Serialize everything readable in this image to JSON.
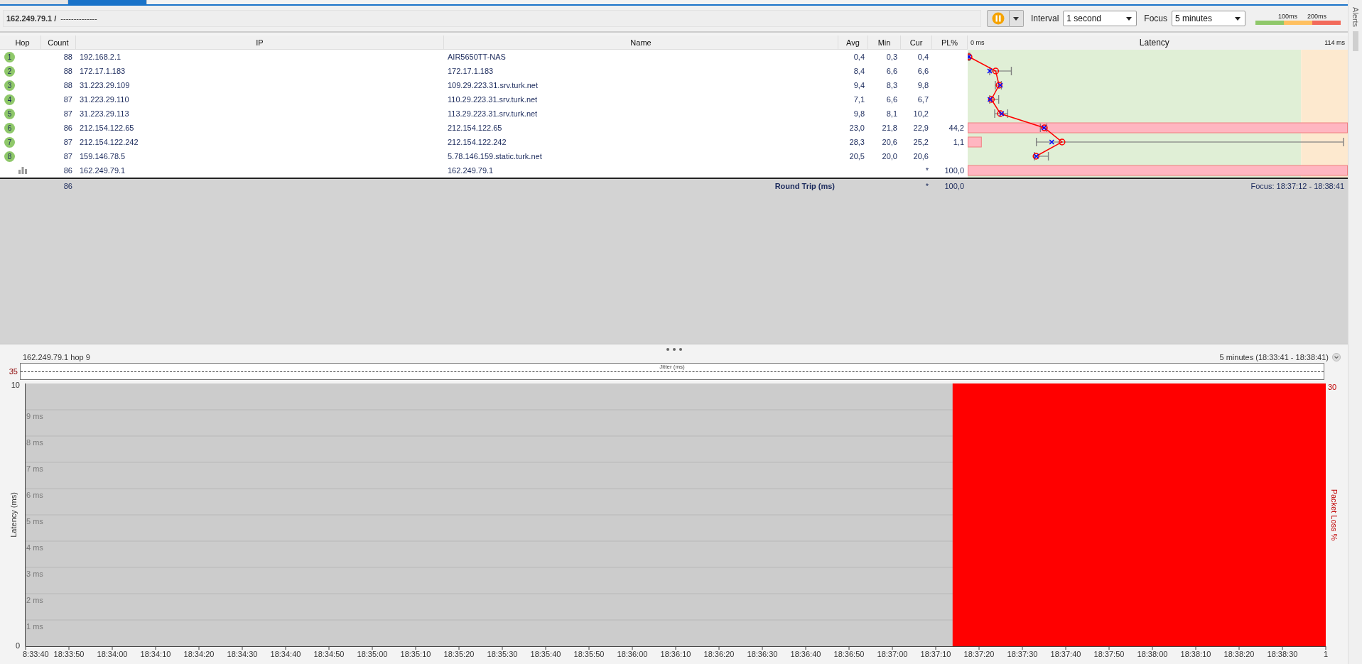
{
  "tabs": [
    {
      "selected": false
    },
    {
      "selected": true
    }
  ],
  "toolbar": {
    "host": "162.249.79.1 /",
    "path": "--------------",
    "running": true,
    "interval": {
      "label": "Interval",
      "value": "1 second"
    },
    "focus": {
      "label": "Focus",
      "value": "5 minutes"
    },
    "legend": [
      "100ms",
      "200ms"
    ]
  },
  "alerts_tab": {
    "label": "Alerts"
  },
  "table": {
    "columns": [
      "Hop",
      "Count",
      "IP",
      "Name",
      "Avg",
      "Min",
      "Cur",
      "PL%"
    ],
    "latency_column": {
      "title": "Latency",
      "min_label": "0 ms",
      "max_label": "114 ms",
      "zones": [
        {
          "color": "#e0efd6",
          "level": 0.877
        },
        {
          "color": "#fde9cf",
          "level": 1
        }
      ]
    },
    "rows": [
      {
        "kind": "hop",
        "hop": "1",
        "count": "88",
        "ip": "192.168.2.1",
        "name": "AIR5650TT-NAS",
        "avg": "0,4",
        "min": "0,3",
        "cur": "0,4",
        "avg_mark": {
          "level": 0.0035
        },
        "cur_mark": {
          "level": 0.0035
        },
        "range": {
          "from": {
            "level": 0.0026
          },
          "to": {
            "level": 0.0053
          }
        }
      },
      {
        "kind": "hop",
        "hop": "2",
        "count": "88",
        "ip": "172.17.1.183",
        "name": "172.17.1.183",
        "avg": "8,4",
        "min": "6,6",
        "cur": "6,6",
        "avg_mark": {
          "level": 0.0737
        },
        "cur_mark": {
          "level": 0.0579
        },
        "range": {
          "from": {
            "level": 0.0579
          },
          "to": {
            "level": 0.1149
          }
        }
      },
      {
        "kind": "hop",
        "hop": "3",
        "count": "88",
        "ip": "31.223.29.109",
        "name": "109.29.223.31.srv.turk.net",
        "avg": "9,4",
        "min": "8,3",
        "cur": "9,8",
        "avg_mark": {
          "level": 0.0825
        },
        "cur_mark": {
          "level": 0.086
        },
        "range": {
          "from": {
            "level": 0.0728
          },
          "to": {
            "level": 0.0886
          }
        }
      },
      {
        "kind": "hop",
        "hop": "4",
        "count": "87",
        "ip": "31.223.29.110",
        "name": "110.29.223.31.srv.turk.net",
        "avg": "7,1",
        "min": "6,6",
        "cur": "6,7",
        "avg_mark": {
          "level": 0.0623
        },
        "cur_mark": {
          "level": 0.0588
        },
        "range": {
          "from": {
            "level": 0.0579
          },
          "to": {
            "level": 0.0816
          }
        }
      },
      {
        "kind": "hop",
        "hop": "5",
        "count": "87",
        "ip": "31.223.29.113",
        "name": "113.29.223.31.srv.turk.net",
        "avg": "9,8",
        "min": "8,1",
        "cur": "10,2",
        "avg_mark": {
          "level": 0.086
        },
        "cur_mark": {
          "level": 0.0895
        },
        "range": {
          "from": {
            "level": 0.0711
          },
          "to": {
            "level": 0.1053
          }
        }
      },
      {
        "kind": "hop",
        "hop": "6",
        "count": "86",
        "ip": "212.154.122.65",
        "name": "212.154.122.65",
        "avg": "23,0",
        "min": "21,8",
        "cur": "22,9",
        "pl": "44,2",
        "avg_mark": {
          "level": 0.2018
        },
        "cur_mark": {
          "level": 0.2009
        },
        "range": {
          "from": {
            "level": 0.1912
          },
          "to": {
            "level": 0.2079
          }
        },
        "loss_bar": {
          "level": 1
        }
      },
      {
        "kind": "hop",
        "hop": "7",
        "count": "87",
        "ip": "212.154.122.242",
        "name": "212.154.122.242",
        "avg": "28,3",
        "min": "20,6",
        "cur": "25,2",
        "pl": "1,1",
        "avg_mark": {
          "level": 0.2482
        },
        "cur_mark": {
          "level": 0.2211
        },
        "range": {
          "from": {
            "level": 0.1807
          },
          "to": {
            "level": 0.9886
          }
        },
        "loss_bar": {
          "level": 0.037
        }
      },
      {
        "kind": "hop",
        "hop": "8",
        "count": "87",
        "ip": "159.146.78.5",
        "name": "5.78.146.159.static.turk.net",
        "avg": "20,5",
        "min": "20,0",
        "cur": "20,6",
        "avg_mark": {
          "level": 0.1798
        },
        "cur_mark": {
          "level": 0.1807
        },
        "range": {
          "from": {
            "level": 0.1754
          },
          "to": {
            "level": 0.2123
          }
        }
      },
      {
        "kind": "target",
        "count": "86",
        "ip": "162.249.79.1",
        "name": "162.249.79.1",
        "cur": "*",
        "pl": "100,0",
        "loss_bar": {
          "level": 1
        }
      }
    ],
    "summary": {
      "count": "86",
      "label": "Round Trip (ms)",
      "cur": "*",
      "pl": "100,0",
      "focus": "Focus: 18:37:12 - 18:38:41"
    }
  },
  "detail": {
    "title": "162.249.79.1 hop 9",
    "range": "5 minutes (18:33:41 - 18:38:41)",
    "jitter": {
      "value": "35",
      "label": "Jitter (ms)"
    },
    "y_axis": {
      "title": "Latency (ms)",
      "labels": [
        "10",
        "9 ms",
        "8 ms",
        "7 ms",
        "6 ms",
        "5 ms",
        "4 ms",
        "3 ms",
        "2 ms",
        "1 ms",
        "0"
      ]
    },
    "y2_axis": {
      "title": "Packet Loss %",
      "label": "30"
    },
    "time_labels": [
      "8:33:40",
      "18:33:50",
      "18:34:00",
      "18:34:10",
      "18:34:20",
      "18:34:30",
      "18:34:40",
      "18:34:50",
      "18:35:00",
      "18:35:10",
      "18:35:20",
      "18:35:30",
      "18:35:40",
      "18:35:50",
      "18:36:00",
      "18:36:10",
      "18:36:20",
      "18:36:30",
      "18:36:40",
      "18:36:50",
      "18:37:00",
      "18:37:10",
      "18:37:20",
      "18:37:30",
      "18:37:40",
      "18:37:50",
      "18:38:00",
      "18:38:10",
      "18:38:20",
      "18:38:30",
      "1"
    ],
    "loss_area": {
      "level": 0.287
    }
  }
}
